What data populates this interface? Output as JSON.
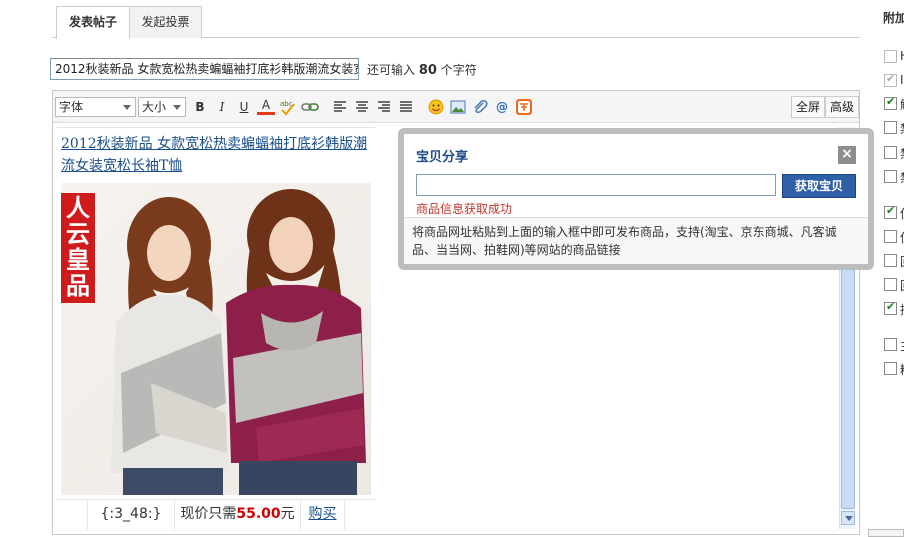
{
  "tabs": [
    {
      "label": "发表帖子",
      "active": true
    },
    {
      "label": "发起投票",
      "active": false
    }
  ],
  "title_field": {
    "value": "2012秋装新品 女款宽松热卖蝙蝠袖打底衫韩版潮流女装宽松长袖T恤",
    "remaining_prefix": "还可输入",
    "remaining_count": "80",
    "remaining_suffix": "个字符"
  },
  "toolbar": {
    "font_select": "字体",
    "size_select": "大小",
    "buttons": [
      "bold-icon",
      "italic-icon",
      "underline-icon",
      "font-color-icon",
      "spellcheck-icon",
      "link-icon",
      "align-left-icon",
      "align-center-icon",
      "align-right-icon",
      "justify-icon",
      "emoticon-icon",
      "image-icon",
      "attachment-icon",
      "mention-icon",
      "taobao-icon"
    ],
    "bold_label": "B",
    "italic_label": "I",
    "underline_label": "U",
    "font_color_label": "A",
    "fullscreen_label": "全屏",
    "advanced_label": "高级"
  },
  "post": {
    "title_link": "2012秋装新品 女款宽松热卖蝙蝠袖打底衫韩版潮流女装宽松长袖T恤",
    "photo_badge": "人云皇品",
    "code": "{:3_48:}",
    "price_prefix": "现价只需",
    "price": "55.00",
    "price_suffix": "元",
    "buy_link": "购买"
  },
  "popup": {
    "title": "宝贝分享",
    "close": "×",
    "input_value": "",
    "button": "获取宝贝",
    "status": "商品信息获取成功",
    "help": "将商品网址粘贴到上面的输入框中即可发布商品，支持(淘宝、京东商城、凡客诚品、当当网、拍鞋网)等网站的商品链接"
  },
  "sidebar": {
    "title": "附加",
    "items": [
      {
        "label": "H",
        "checked": false,
        "disabled": true
      },
      {
        "label": "Ⅰ",
        "checked": true,
        "disabled": true
      },
      {
        "label": "解",
        "checked": true,
        "disabled": false
      },
      {
        "label": "禁",
        "checked": false,
        "disabled": false
      },
      {
        "label": "禁",
        "checked": false,
        "disabled": false
      },
      {
        "label": "禁",
        "checked": false,
        "disabled": false
      },
      {
        "label": "使",
        "checked": true,
        "disabled": false
      },
      {
        "label": "使",
        "checked": false,
        "disabled": false
      },
      {
        "label": "回",
        "checked": false,
        "disabled": false
      },
      {
        "label": "回",
        "checked": false,
        "disabled": false
      },
      {
        "label": "接",
        "checked": true,
        "disabled": false
      },
      {
        "label": "主",
        "checked": false,
        "disabled": false
      },
      {
        "label": "精",
        "checked": false,
        "disabled": false
      }
    ]
  }
}
